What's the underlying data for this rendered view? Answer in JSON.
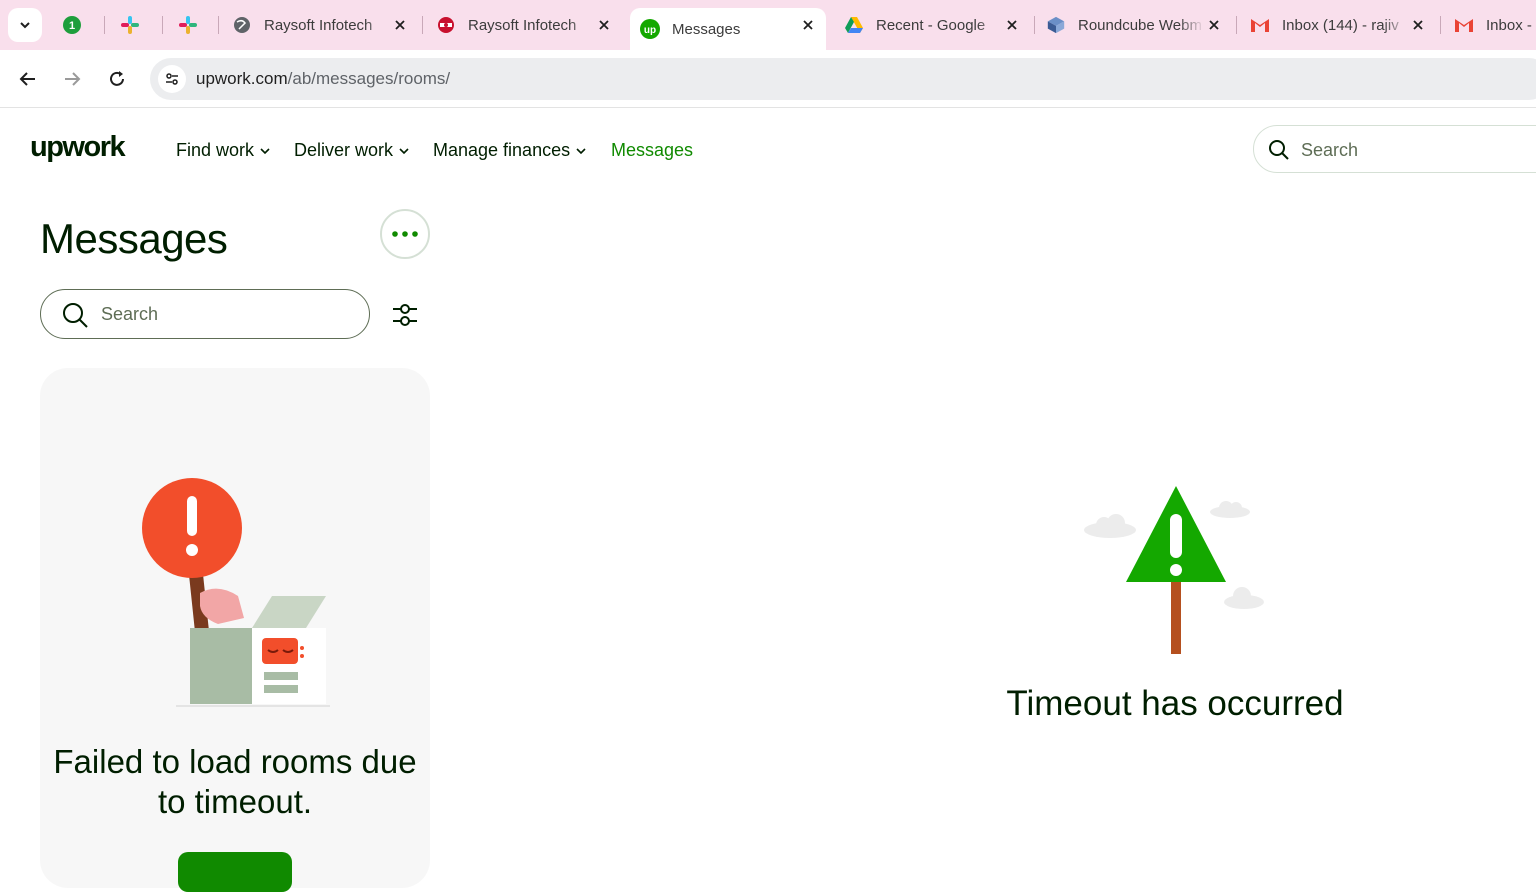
{
  "browser": {
    "tabs": [
      {
        "title": "",
        "icon": "green-badge-icon"
      },
      {
        "title": "",
        "icon": "slack-icon"
      },
      {
        "title": "",
        "icon": "slack-icon"
      },
      {
        "title": "Raysoft Infotech",
        "icon": "globe-icon"
      },
      {
        "title": "Raysoft Infotech",
        "icon": "raysoft-logo-icon"
      },
      {
        "title": "Messages",
        "icon": "upwork-icon",
        "active": true
      },
      {
        "title": "Recent - Google",
        "icon": "google-drive-icon"
      },
      {
        "title": "Roundcube Webm",
        "icon": "roundcube-icon"
      },
      {
        "title": "Inbox (144) - rajiv",
        "icon": "gmail-icon"
      },
      {
        "title": "Inbox -",
        "icon": "gmail-icon"
      }
    ],
    "url_host": "upwork.com",
    "url_path": "/ab/messages/rooms/"
  },
  "header": {
    "logo": "upwork",
    "nav": [
      {
        "label": "Find work",
        "dropdown": true
      },
      {
        "label": "Deliver work",
        "dropdown": true
      },
      {
        "label": "Manage finances",
        "dropdown": true
      },
      {
        "label": "Messages",
        "dropdown": false,
        "active": true
      }
    ],
    "search_placeholder": "Search"
  },
  "sidebar": {
    "title": "Messages",
    "search_placeholder": "Search",
    "error_message": "Failed to load rooms due to timeout."
  },
  "main": {
    "error_message": "Timeout has occurred"
  },
  "colors": {
    "brand_green": "#108a00",
    "tab_strip": "#f9dfec",
    "alert_red": "#f24e2b"
  }
}
